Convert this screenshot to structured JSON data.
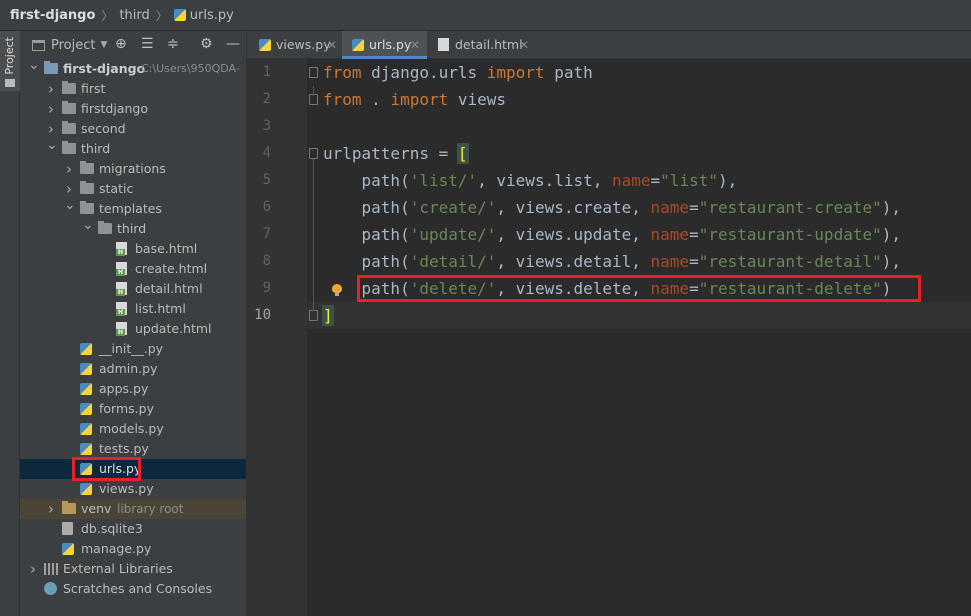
{
  "breadcrumb": {
    "project": "first-django",
    "folder": "third",
    "file": "urls.py"
  },
  "side_stripe": {
    "tab_label": "Project"
  },
  "project_panel": {
    "title": "Project",
    "tree": [
      {
        "label": "first-django",
        "hint": "C:\\Users\\950QDA-",
        "kind": "root"
      },
      {
        "label": "first",
        "kind": "folder"
      },
      {
        "label": "firstdjango",
        "kind": "folder"
      },
      {
        "label": "second",
        "kind": "folder"
      },
      {
        "label": "third",
        "kind": "folder"
      },
      {
        "label": "migrations",
        "kind": "folder"
      },
      {
        "label": "static",
        "kind": "folder"
      },
      {
        "label": "templates",
        "kind": "folder"
      },
      {
        "label": "third",
        "kind": "folder"
      },
      {
        "label": "base.html",
        "kind": "html"
      },
      {
        "label": "create.html",
        "kind": "html"
      },
      {
        "label": "detail.html",
        "kind": "html"
      },
      {
        "label": "list.html",
        "kind": "html"
      },
      {
        "label": "update.html",
        "kind": "html"
      },
      {
        "label": "__init__.py",
        "kind": "py"
      },
      {
        "label": "admin.py",
        "kind": "py"
      },
      {
        "label": "apps.py",
        "kind": "py"
      },
      {
        "label": "forms.py",
        "kind": "py"
      },
      {
        "label": "models.py",
        "kind": "py"
      },
      {
        "label": "tests.py",
        "kind": "py"
      },
      {
        "label": "urls.py",
        "kind": "py",
        "selected": true
      },
      {
        "label": "views.py",
        "kind": "py"
      },
      {
        "label": "venv",
        "hint": "library root",
        "kind": "excluded"
      },
      {
        "label": "db.sqlite3",
        "kind": "db"
      },
      {
        "label": "manage.py",
        "kind": "py"
      },
      {
        "label": "External Libraries",
        "kind": "lib"
      },
      {
        "label": "Scratches and Consoles",
        "kind": "scratch"
      }
    ]
  },
  "editor_tabs": [
    {
      "label": "views.py",
      "active": false
    },
    {
      "label": "urls.py",
      "active": true
    },
    {
      "label": "detail.html",
      "active": false
    }
  ],
  "editor": {
    "current_line": 10,
    "line_numbers": [
      "1",
      "2",
      "3",
      "4",
      "5",
      "6",
      "7",
      "8",
      "9",
      "10"
    ],
    "code": {
      "l1": {
        "kw1": "from",
        "mod": " django.urls ",
        "kw2": "import",
        "name": " path"
      },
      "l2": {
        "kw1": "from",
        "mod": " . ",
        "kw2": "import",
        "name": " views"
      },
      "l4": {
        "ident": "urlpatterns = ",
        "bracket": "["
      },
      "l5": {
        "call": "    path(",
        "route": "'list/'",
        "view": ", views.list, ",
        "kw": "name",
        "eq": "=",
        "name": "\"list\"",
        "end": "),"
      },
      "l6": {
        "call": "    path(",
        "route": "'create/'",
        "view": ", views.create, ",
        "kw": "name",
        "eq": "=",
        "name": "\"restaurant-create\"",
        "end": "),"
      },
      "l7": {
        "call": "    path(",
        "route": "'update/'",
        "view": ", views.update, ",
        "kw": "name",
        "eq": "=",
        "name": "\"restaurant-update\"",
        "end": "),"
      },
      "l8": {
        "call": "    path(",
        "route": "'detail/'",
        "view": ", views.detail, ",
        "kw": "name",
        "eq": "=",
        "name": "\"restaurant-detail\"",
        "end": "),"
      },
      "l9": {
        "call": "    path(",
        "route": "'delete/'",
        "view": ", views.delete, ",
        "kw": "name",
        "eq": "=",
        "name": "\"restaurant-delete\"",
        "end": ")"
      },
      "l10": {
        "bracket": "]"
      }
    }
  },
  "colors": {
    "highlight_box": "#e8202a",
    "keyword": "#cc7832",
    "string": "#6a8759",
    "param": "#aa4926"
  }
}
